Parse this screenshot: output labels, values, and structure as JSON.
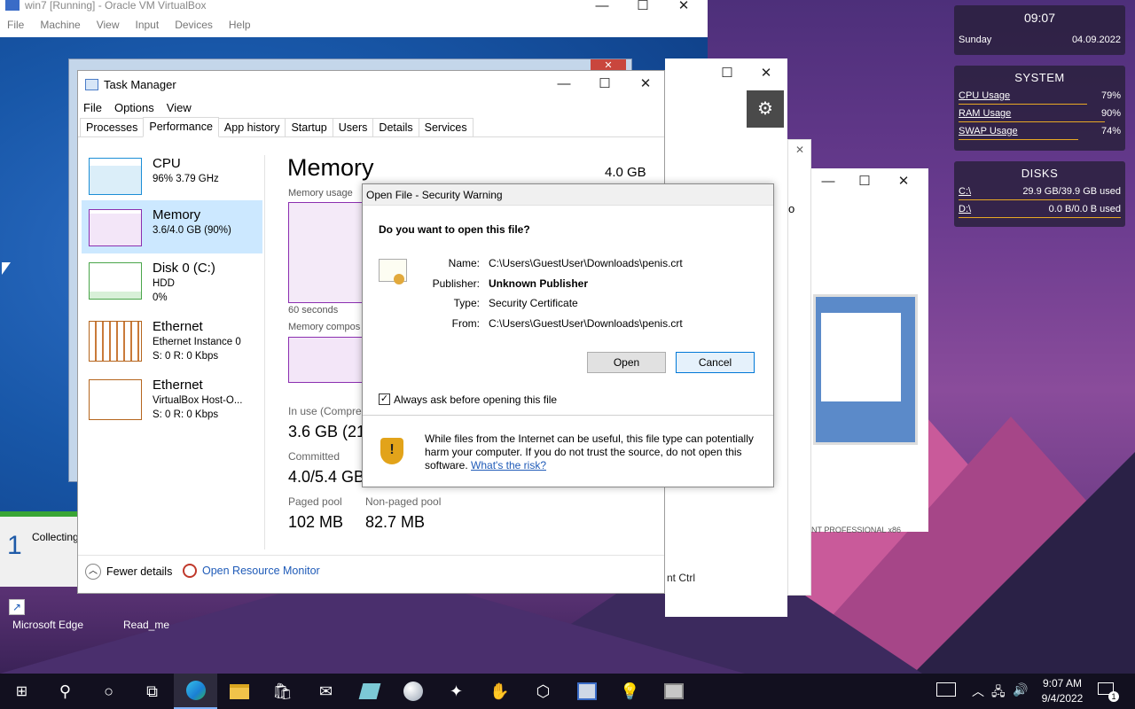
{
  "vbox": {
    "title": "win7 [Running] - Oracle VM VirtualBox",
    "menu": [
      "File",
      "Machine",
      "View",
      "Input",
      "Devices",
      "Help"
    ],
    "vm_status_num": "1",
    "vm_status_text": "Collecting"
  },
  "taskmgr": {
    "title": "Task Manager",
    "menu": [
      "File",
      "Options",
      "View"
    ],
    "tabs": [
      "Processes",
      "Performance",
      "App history",
      "Startup",
      "Users",
      "Details",
      "Services"
    ],
    "side": [
      {
        "name": "CPU",
        "line1": "96%  3.79 GHz",
        "line2": ""
      },
      {
        "name": "Memory",
        "line1": "3.6/4.0 GB (90%)",
        "line2": ""
      },
      {
        "name": "Disk 0 (C:)",
        "line1": "HDD",
        "line2": "0%"
      },
      {
        "name": "Ethernet",
        "line1": "Ethernet Instance 0",
        "line2": "S: 0  R: 0 Kbps"
      },
      {
        "name": "Ethernet",
        "line1": "VirtualBox Host-O...",
        "line2": "S: 0  R: 0 Kbps"
      }
    ],
    "main_title": "Memory",
    "total": "4.0 GB",
    "usage_label": "Memory usage",
    "seconds": "60 seconds",
    "composition_label": "Memory compos",
    "inuse_label": "In use (Compres",
    "inuse_value": "3.6 GB (21",
    "committed_label": "Committed",
    "committed_value": "4.0/5.4 GB",
    "paged_label": "Paged pool",
    "paged_value": "102 MB",
    "nonpaged_label": "Non-paged pool",
    "nonpaged_value": "82.7 MB",
    "fewer_details": "Fewer details",
    "open_resmon": "Open Resource Monitor"
  },
  "dialog": {
    "title": "Open File - Security Warning",
    "question": "Do you want to open this file?",
    "fields": [
      {
        "label": "Name:",
        "value": "C:\\Users\\GuestUser\\Downloads\\penis.crt"
      },
      {
        "label": "Publisher:",
        "value": "Unknown Publisher"
      },
      {
        "label": "Type:",
        "value": "Security Certificate"
      },
      {
        "label": "From:",
        "value": "C:\\Users\\GuestUser\\Downloads\\penis.crt"
      }
    ],
    "open_label": "Open",
    "cancel_label": "Cancel",
    "checkbox_label": "Always ask before opening this file",
    "checkbox_checked": true,
    "warning_text": "While files from the Internet can be useful, this file type can potentially harm your computer. If you do not trust the source, do not open this software.",
    "risk_link": "What's the risk?"
  },
  "bg_window": {
    "char_o": "o",
    "footer_text": "NT PROFESSIONAL  x86",
    "ctrl_text": "nt Ctrl"
  },
  "gadgets": {
    "time": "09:07",
    "day": "Sunday",
    "date": "04.09.2022",
    "system_title": "SYSTEM",
    "system": [
      {
        "label": "CPU Usage",
        "value": "79%",
        "pct": 0.79
      },
      {
        "label": "RAM Usage",
        "value": "90%",
        "pct": 0.9
      },
      {
        "label": "SWAP Usage",
        "value": "74%",
        "pct": 0.74
      }
    ],
    "disks_title": "DISKS",
    "disks": [
      {
        "label": "C:\\",
        "value": "29.9 GB/39.9 GB used",
        "pct": 0.75
      },
      {
        "label": "D:\\",
        "value": "0.0 B/0.0 B used",
        "pct": 1.0
      }
    ]
  },
  "desktop_icons": [
    "Microsoft Edge",
    "Read_me"
  ],
  "taskbar": {
    "time": "9:07 AM",
    "date": "9/4/2022",
    "notification_count": "1"
  }
}
